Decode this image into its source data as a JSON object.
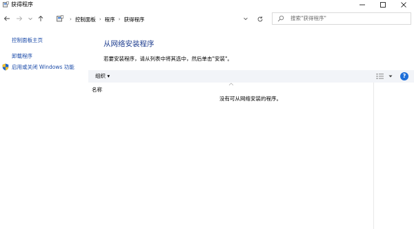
{
  "window": {
    "title": "获得程序",
    "icon": "control-panel-icon",
    "controls": [
      "minimize-icon",
      "maximize-icon",
      "close-icon"
    ]
  },
  "nav": {
    "breadcrumb": [
      "控制面板",
      "程序",
      "获得程序"
    ],
    "search_placeholder": "搜索\"获得程序\""
  },
  "sidebar": {
    "items": [
      {
        "label": "控制面板主页"
      },
      {
        "label": "卸载程序"
      },
      {
        "label": "启用或关闭 Windows 功能",
        "icon": "shield-icon"
      }
    ]
  },
  "main": {
    "heading": "从网络安装程序",
    "instruction": "若要安装程序，请从列表中将其选中，然后单击\"安装\"。",
    "toolbar": {
      "organize": "组织 ▾"
    },
    "columns": [
      {
        "label": "名称"
      }
    ],
    "empty_message": "没有可从网络安装的程序。"
  },
  "colors": {
    "link": "#1a4aa8",
    "heading": "#1e3d8f",
    "toolbar_bg": "#f2f4f8",
    "help": "#1e6fd9"
  }
}
